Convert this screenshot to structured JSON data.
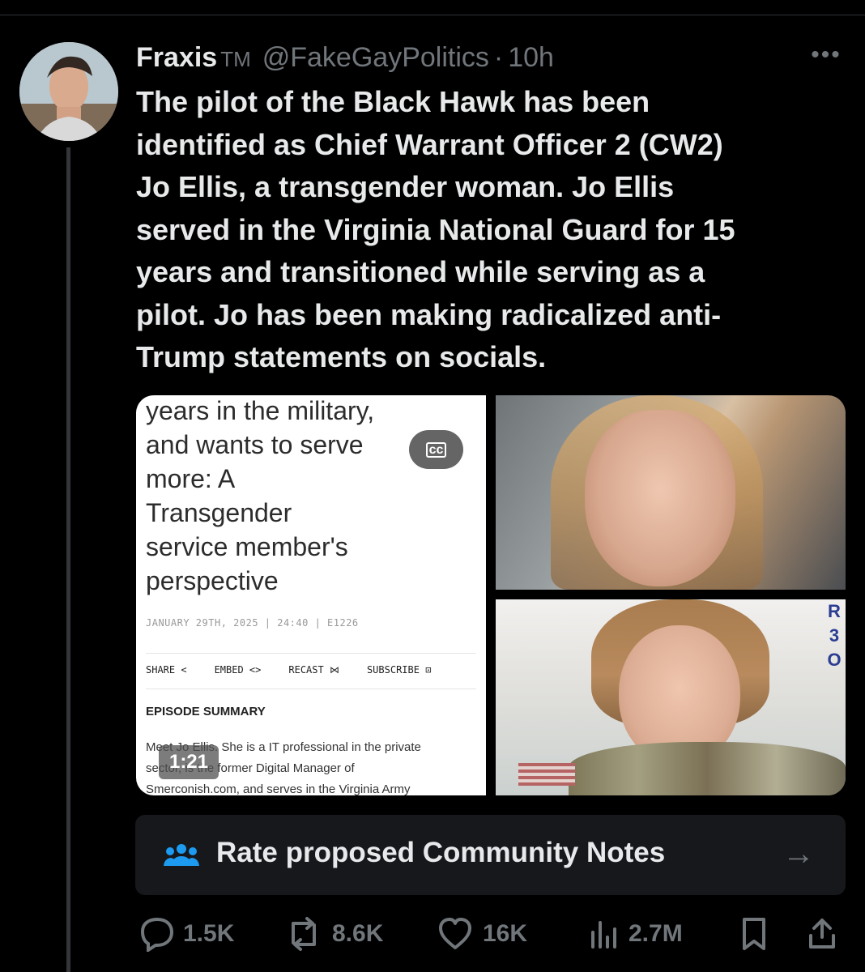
{
  "tweet": {
    "author_name": "Fraxis",
    "trademark": "TM",
    "handle": "@FakeGayPolitics",
    "separator": "·",
    "time": "10h",
    "more_label": "•••",
    "text": "The pilot of the Black Hawk has been\nidentified as Chief Warrant Officer 2 (CW2)\nJo Ellis, a transgender woman. Jo Ellis\nserved in the Virginia National Guard for 15\nyears and transitioned while serving as a\npilot. Jo has been making radicalized anti-\nTrump statements on socials."
  },
  "media": {
    "article": {
      "headline": "years in the military,\nand wants to serve\nmore: A\nTransgender\nservice member's\nperspective",
      "cc_label": "cc",
      "meta": "JANUARY 29TH, 2025 | 24:40 | E1226",
      "actions": [
        "SHARE <",
        "EMBED <>",
        "RECAST ⋈",
        "SUBSCRIBE ⊡"
      ],
      "summary_title": "EPISODE SUMMARY",
      "summary_text": "Meet Jo Ellis. She is a IT professional in the private\nsector, is the former Digital Manager of\nSmerconish.com, and serves in the Virginia Army",
      "duration": "1:21"
    },
    "photo_top": {
      "icon": "portrait-photo"
    },
    "photo_bottom": {
      "icon": "uniform-portrait-photo",
      "side_text": "R\n3\nO"
    }
  },
  "community_notes": {
    "label": "Rate proposed Community Notes",
    "arrow": "→",
    "icon": "people-icon"
  },
  "footer": {
    "replies": "1.5K",
    "reposts": "8.6K",
    "likes": "16K",
    "views": "2.7M"
  },
  "colors": {
    "background": "#000000",
    "primary_text": "#e7e9ea",
    "secondary_text": "#71767b",
    "card_background": "#16181c",
    "notes_icon": "#1d9bf0"
  }
}
